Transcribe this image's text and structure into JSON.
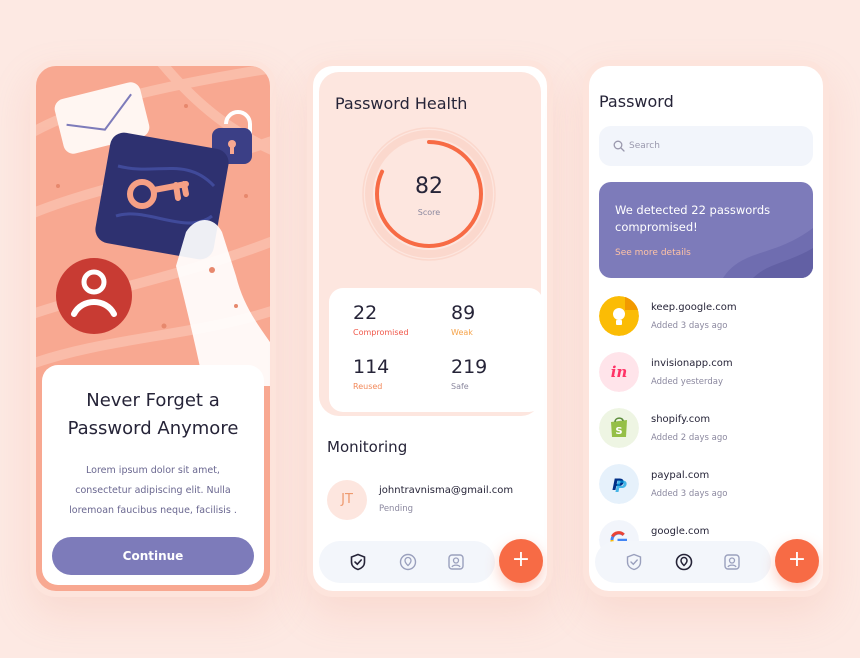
{
  "colors": {
    "page_bg": "#fde9e3",
    "accent_orange": "#f76b45",
    "accent_purple": "#7d7bba",
    "peach": "#f8a891",
    "navy": "#2e3170"
  },
  "onboarding": {
    "title": "Never Forget a\nPassword Anymore",
    "body": "Lorem ipsum dolor sit amet, consectetur adipiscing elit. Nulla loremoan faucibus neque, facilisis .",
    "cta_label": "Continue",
    "illustration_icons": [
      "envelope-icon",
      "padlock-icon",
      "key-icon",
      "user-icon"
    ]
  },
  "health": {
    "title": "Password Health",
    "score": "82",
    "score_label": "Score",
    "score_fraction": 0.82,
    "stats": [
      {
        "value": "22",
        "label": "Compromised",
        "color": "#f0584a"
      },
      {
        "value": "89",
        "label": "Weak",
        "color": "#f5a34a"
      },
      {
        "value": "114",
        "label": "Reused",
        "color": "#f2895a"
      },
      {
        "value": "219",
        "label": "Safe",
        "color": "#8b889f"
      }
    ],
    "monitoring_title": "Monitoring",
    "monitor": {
      "initials": "JT",
      "email": "johntravnisma@gmail.com",
      "status": "Pending"
    },
    "nav_icons": [
      "shield-check-icon",
      "location-pin-icon",
      "profile-icon"
    ],
    "fab_icon": "plus-icon"
  },
  "passwords": {
    "title": "Password",
    "search_placeholder": "Search",
    "alert_text": "We detected 22 passwords compromised!",
    "alert_link": "See more details",
    "items": [
      {
        "site": "keep.google.com",
        "added": "Added 3 days ago",
        "icon": "google-keep-icon",
        "color": "#fbbc05"
      },
      {
        "site": "invisionapp.com",
        "added": "Added yesterday",
        "icon": "invision-icon",
        "color": "#ff3366"
      },
      {
        "site": "shopify.com",
        "added": "Added 2 days ago",
        "icon": "shopify-icon",
        "color": "#95bf47"
      },
      {
        "site": "paypal.com",
        "added": "Added 3 days ago",
        "icon": "paypal-icon",
        "color": "#003087"
      },
      {
        "site": "google.com",
        "added": "",
        "icon": "google-icon",
        "color": "#4285f4"
      }
    ],
    "nav_icons": [
      "shield-check-icon",
      "location-pin-icon",
      "profile-icon"
    ],
    "fab_icon": "plus-icon"
  }
}
